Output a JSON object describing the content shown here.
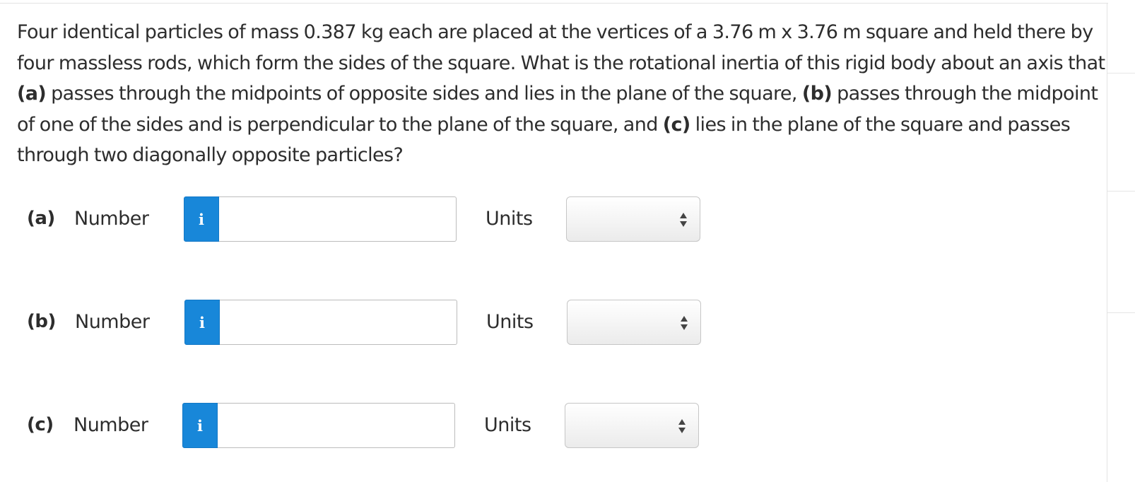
{
  "question": {
    "intro": "Four identical particles of mass 0.387 kg each are placed at the vertices of a 3.76 m x 3.76 m square and held there by four massless rods, which form the sides of the square. What is the rotational inertia of this rigid body about an axis that ",
    "part_a_tag": "(a)",
    "part_a_text": " passes through the midpoints of opposite sides and lies in the plane of the square, ",
    "part_b_tag": "(b)",
    "part_b_text": " passes through the midpoint of one of the sides and is perpendicular to the plane of the square, and ",
    "part_c_tag": "(c)",
    "part_c_text": " lies in the plane of the square and passes through two diagonally opposite particles?"
  },
  "answers": [
    {
      "part": "(a)",
      "number_label": "Number",
      "info_icon": "i",
      "value": "",
      "units_label": "Units",
      "units_selected": ""
    },
    {
      "part": "(b)",
      "number_label": "Number",
      "info_icon": "i",
      "value": "",
      "units_label": "Units",
      "units_selected": ""
    },
    {
      "part": "(c)",
      "number_label": "Number",
      "info_icon": "i",
      "value": "",
      "units_label": "Units",
      "units_selected": ""
    }
  ],
  "colors": {
    "info_button": "#1887d9",
    "text": "#2d2d2d",
    "input_border": "#bcbcbc"
  },
  "icons": {
    "info": "info-icon",
    "select_arrows": "up-down-arrows-icon"
  }
}
